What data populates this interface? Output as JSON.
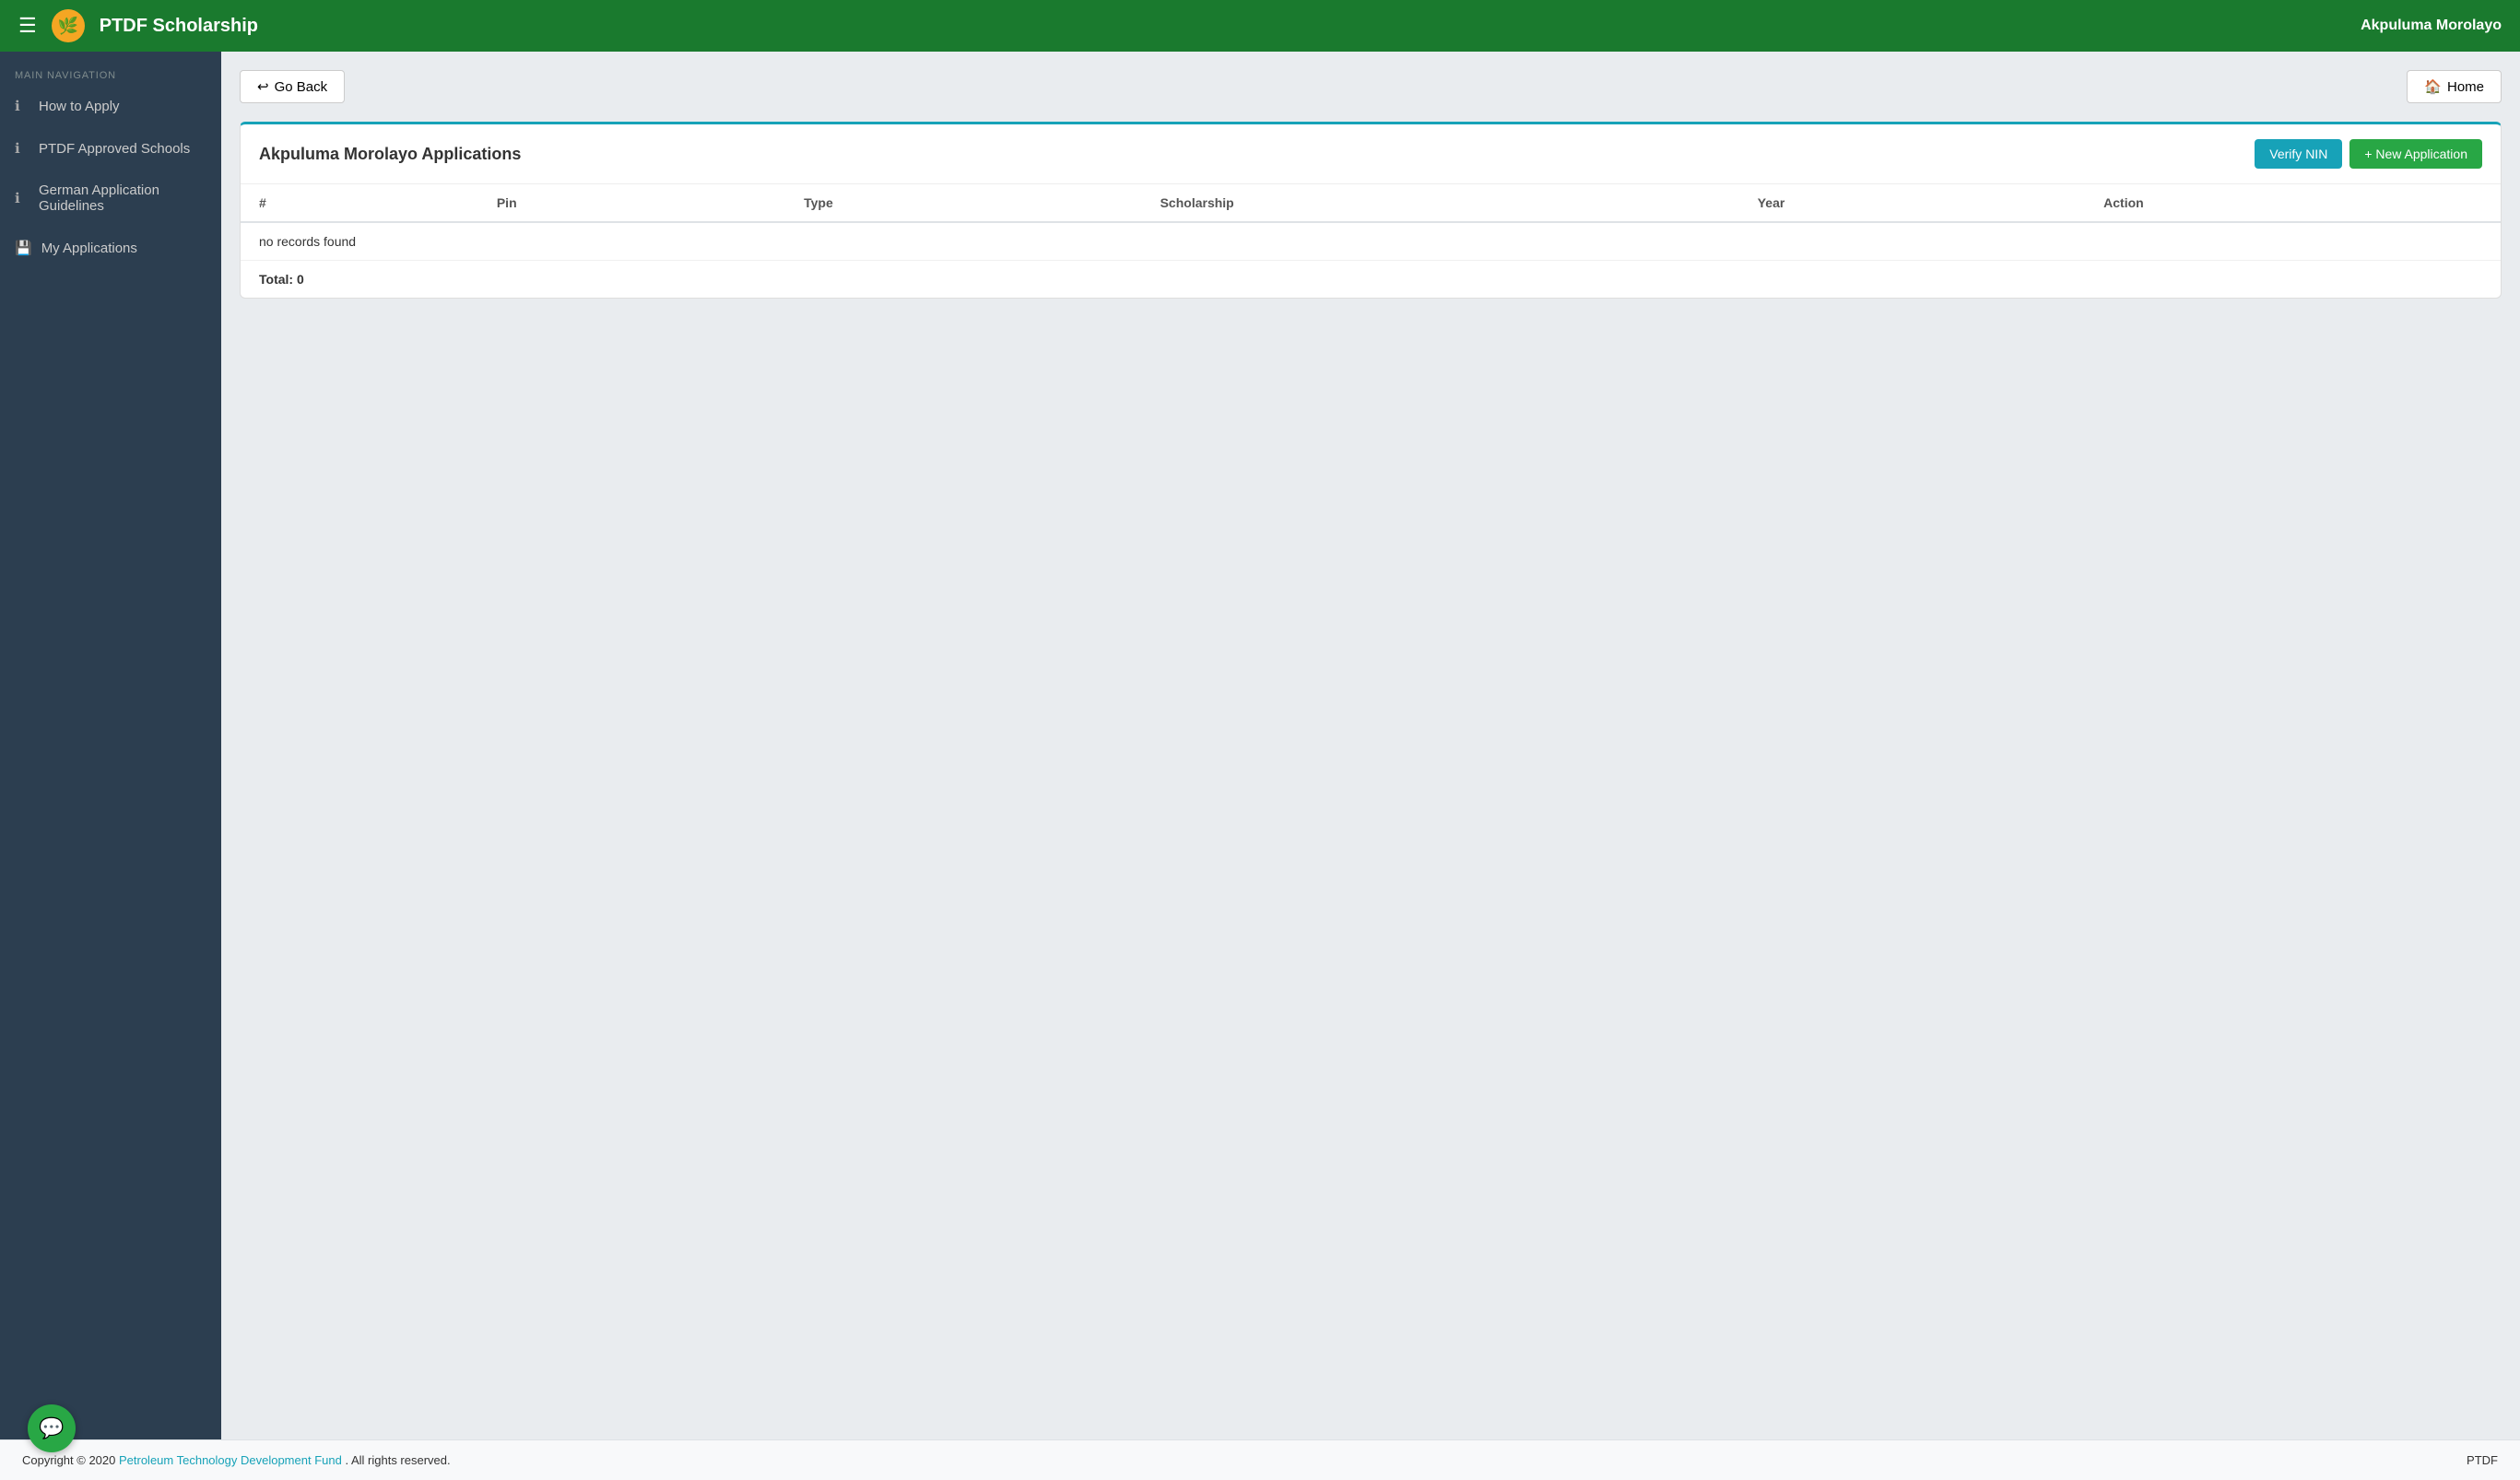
{
  "navbar": {
    "logo_emoji": "🌟",
    "title": "PTDF Scholarship",
    "hamburger_icon": "☰",
    "user": "Akpuluma Morolayo"
  },
  "sidebar": {
    "nav_label": "MAIN NAVIGATION",
    "items": [
      {
        "id": "how-to-apply",
        "label": "How to Apply",
        "icon": "ℹ"
      },
      {
        "id": "ptdf-approved-schools",
        "label": "PTDF Approved Schools",
        "icon": "ℹ"
      },
      {
        "id": "german-application-guidelines",
        "label": "German Application Guidelines",
        "icon": "ℹ"
      },
      {
        "id": "my-applications",
        "label": "My Applications",
        "icon": "💾"
      }
    ]
  },
  "topbar": {
    "go_back_label": "Go Back",
    "go_back_icon": "⟳",
    "home_label": "Home",
    "home_icon": "🏠"
  },
  "card": {
    "title": "Akpuluma Morolayo Applications",
    "verify_nin_label": "Verify NIN",
    "new_application_label": "+ New Application",
    "table": {
      "columns": [
        "#",
        "Pin",
        "Type",
        "Scholarship",
        "Year",
        "Action"
      ],
      "no_records": "no records found",
      "total_label": "Total: 0"
    }
  },
  "footer": {
    "copyright": "Copyright © 2020",
    "fund_name": "Petroleum Technology Development Fund",
    "rights": ". All rights reserved.",
    "brand": "PTDF"
  },
  "chat": {
    "icon": "💬"
  }
}
